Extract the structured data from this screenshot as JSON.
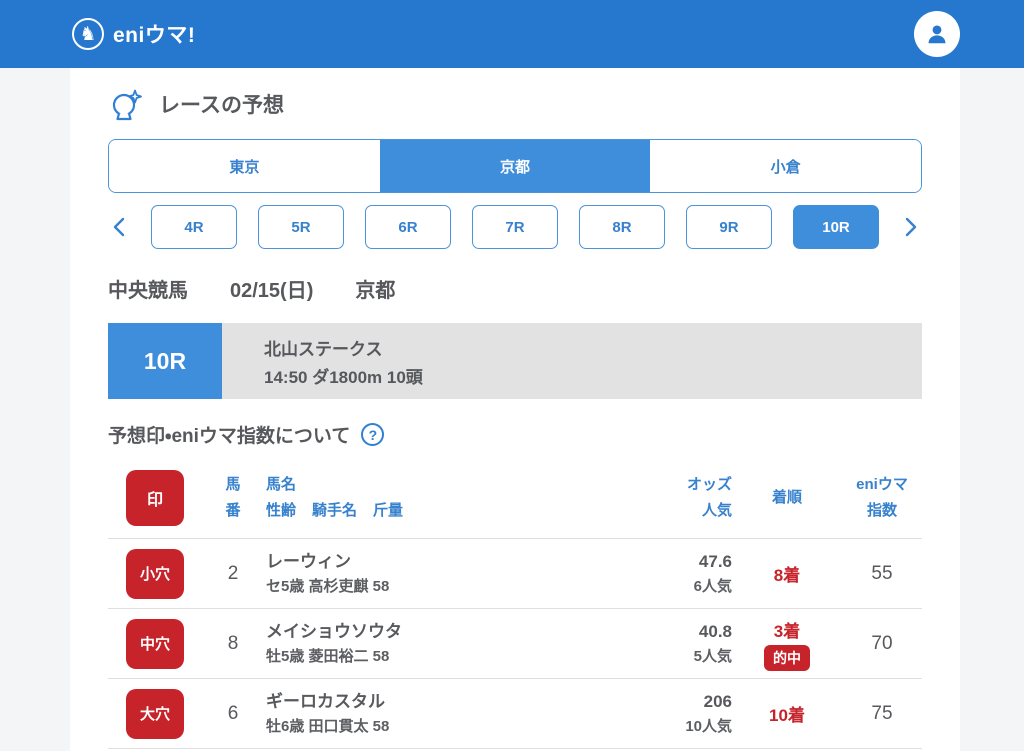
{
  "header": {
    "logo_text": "eniウマ!",
    "logo_icon": "horse-knight-icon",
    "logo_glyph": "♞",
    "user_icon": "user-icon"
  },
  "page": {
    "title": "レースの予想",
    "title_icon": "crystal-ball-icon"
  },
  "venue_tabs": [
    {
      "label": "東京",
      "selected": false
    },
    {
      "label": "京都",
      "selected": true
    },
    {
      "label": "小倉",
      "selected": false
    }
  ],
  "race_nav": {
    "prev_icon": "chevron-left-icon",
    "next_icon": "chevron-right-icon",
    "races": [
      {
        "label": "4R",
        "selected": false
      },
      {
        "label": "5R",
        "selected": false
      },
      {
        "label": "6R",
        "selected": false
      },
      {
        "label": "7R",
        "selected": false
      },
      {
        "label": "8R",
        "selected": false
      },
      {
        "label": "9R",
        "selected": false
      },
      {
        "label": "10R",
        "selected": true
      }
    ]
  },
  "race_meta": {
    "category": "中央競馬",
    "date": "02/15(日)",
    "venue": "京都"
  },
  "race_banner": {
    "race_no": "10R",
    "name": "北山ステークス",
    "details": "14:50 ダ1800m 10頭"
  },
  "about": {
    "label": "予想印・eniウマ指数について",
    "help_icon": "question-mark-icon",
    "help_glyph": "?"
  },
  "table": {
    "headers": {
      "mark": "印",
      "number_line1": "馬",
      "number_line2": "番",
      "name_line1": "馬名",
      "name_sub": [
        "性齢",
        "騎手名",
        "斤量"
      ],
      "odds_line1": "オッズ",
      "odds_line2": "人気",
      "result": "着順",
      "index_line1": "eniウマ",
      "index_line2": "指数"
    },
    "rows": [
      {
        "mark": "小穴",
        "number": "2",
        "horse_name": "レーウィン",
        "horse_info": "セ5歳 高杉吏麒 58",
        "odds": "47.6",
        "popularity": "6人気",
        "result": "8着",
        "hit_badge": "",
        "index": "55"
      },
      {
        "mark": "中穴",
        "number": "8",
        "horse_name": "メイショウソウタ",
        "horse_info": "牡5歳 菱田裕二 58",
        "odds": "40.8",
        "popularity": "5人気",
        "result": "3着",
        "hit_badge": "的中",
        "index": "70"
      },
      {
        "mark": "大穴",
        "number": "6",
        "horse_name": "ギーロカスタル",
        "horse_info": "牡6歳 田口貫太 58",
        "odds": "206",
        "popularity": "10人気",
        "result": "10着",
        "hit_badge": "",
        "index": "75"
      }
    ]
  },
  "colors": {
    "header_blue": "#2677ce",
    "accent_blue": "#3e8edb",
    "border_blue": "#4a94da",
    "link_blue": "#3781cd",
    "mark_red": "#c7232b",
    "text_gray": "#57595d",
    "page_bg": "#f3f5f7",
    "banner_gray": "#e2e2e3",
    "divider": "#dfdfdf"
  }
}
